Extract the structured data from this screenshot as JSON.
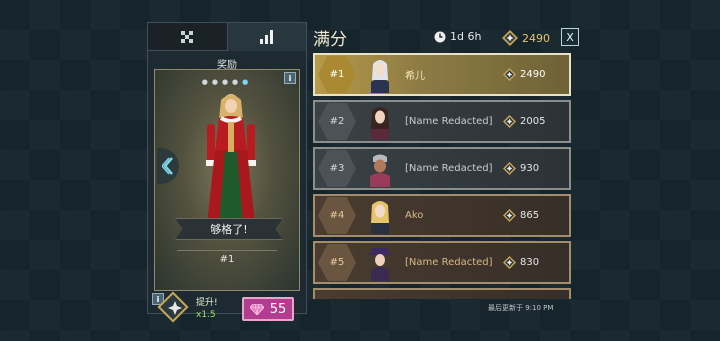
{
  "left_panel": {
    "tab_icons": [
      "checker-icon",
      "bar-chart-icon"
    ],
    "title": "奖励",
    "reward_banner": "够格了!",
    "reward_rank": "#1",
    "boost_label": "提升!",
    "boost_multiplier": "x1.5",
    "gem_cost": "55"
  },
  "header": {
    "title": "满分",
    "timer": "1d 6h",
    "currency": "2490",
    "close_label": "X"
  },
  "leaderboard": [
    {
      "rank": "#1",
      "name": "希儿",
      "score": "2490"
    },
    {
      "rank": "#2",
      "name": "[Name Redacted]",
      "score": "2005"
    },
    {
      "rank": "#3",
      "name": "[Name Redacted]",
      "score": "930"
    },
    {
      "rank": "#4",
      "name": "Ako",
      "score": "865"
    },
    {
      "rank": "#5",
      "name": "[Name Redacted]",
      "score": "830"
    }
  ],
  "footer": {
    "last_updated": "最后更新于 9:10 PM"
  },
  "colors": {
    "gold": "#e5c46c",
    "gem": "#b23c8f",
    "boost_green": "#9fe06a"
  }
}
